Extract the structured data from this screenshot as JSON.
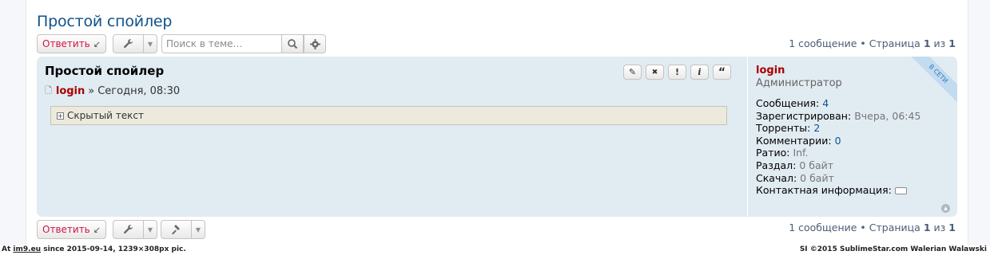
{
  "topic": {
    "title": "Простой спойлер"
  },
  "toolbar": {
    "reply_label": "Ответить",
    "reply_icon": "↙",
    "tools_icon": "wrench-icon",
    "search_placeholder": "Поиск в теме…",
    "mod_tools_icon": "hammer-icon"
  },
  "pagination": {
    "count_text": "1 сообщение • Страница",
    "current": "1",
    "of": "из",
    "total": "1"
  },
  "post": {
    "subject": "Простой спойлер",
    "author": "login",
    "separator": "»",
    "date": "Сегодня, 08:30",
    "spoiler_label": "Скрытый текст",
    "buttons": {
      "edit": "✎",
      "delete": "✖",
      "report": "!",
      "info": "i",
      "quote": "“"
    }
  },
  "profile": {
    "username": "login",
    "rank": "Администратор",
    "online_ribbon": "В СЕТИ",
    "fields": {
      "posts_label": "Сообщения:",
      "posts_value": "4",
      "registered_label": "Зарегистрирован:",
      "registered_value": "Вчера, 06:45",
      "torrents_label": "Торренты:",
      "torrents_value": "2",
      "comments_label": "Комментарии:",
      "comments_value": "0",
      "ratio_label": "Ратио:",
      "ratio_value": "Inf.",
      "upload_label": "Раздал:",
      "upload_value": "0 байт",
      "download_label": "Скачал:",
      "download_value": "0 байт",
      "contact_label": "Контактная информация:"
    }
  },
  "footer": {
    "left_prefix": "At",
    "left_site": "im9.eu",
    "left_suffix": "since 2015-09-14, 1239×308px pic.",
    "right": "SI ©2015 SublimeStar.com Walerian Walawski"
  },
  "colors": {
    "title": "#105289",
    "author": "#aa0000",
    "post_bg": "#e1ebf2",
    "reply": "#d31141"
  }
}
